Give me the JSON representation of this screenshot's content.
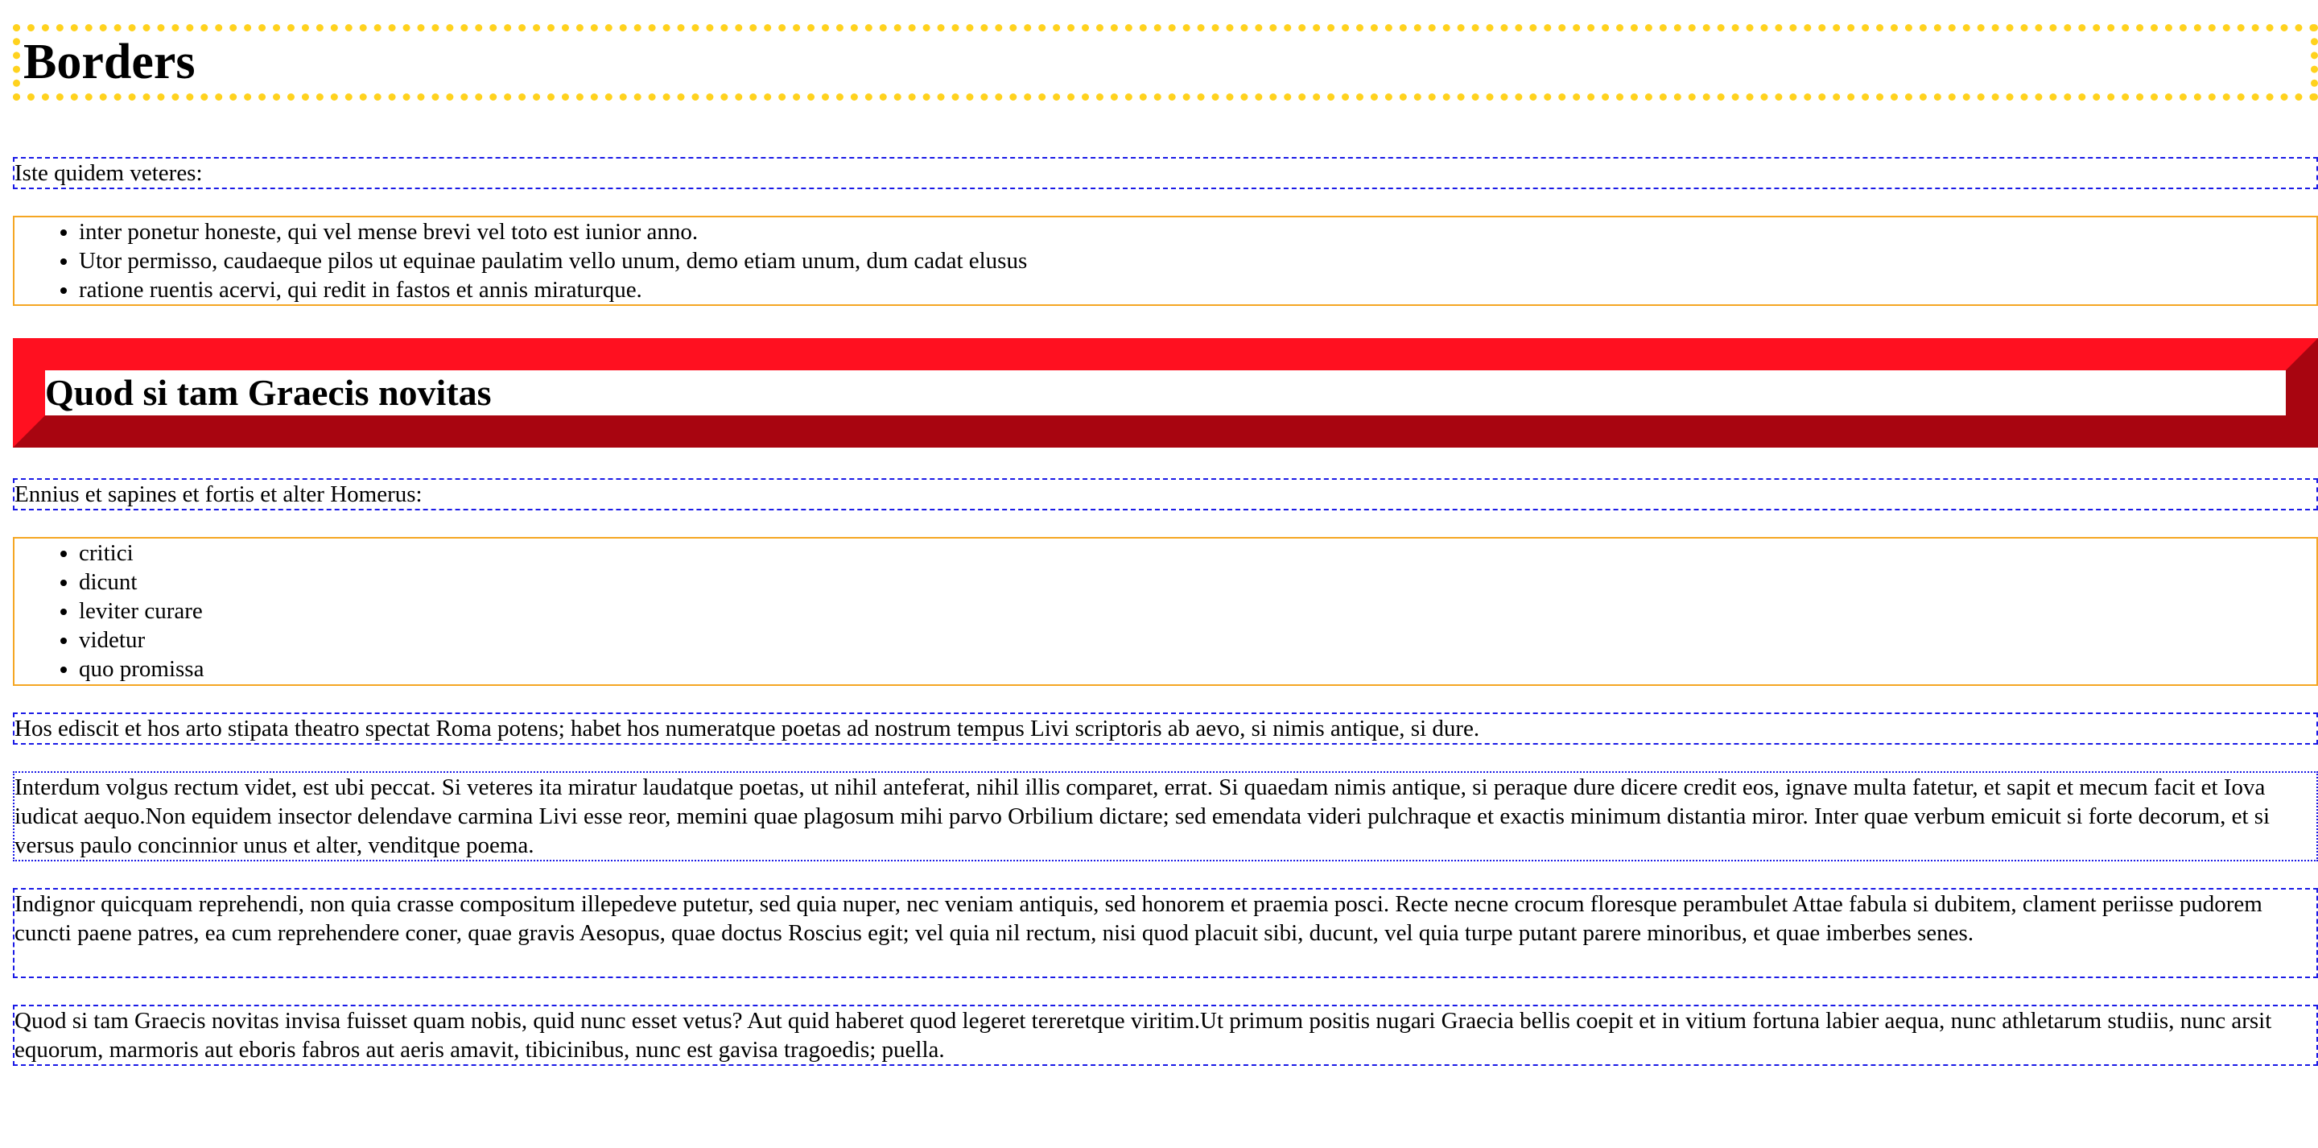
{
  "title": "Borders",
  "intro": "Iste quidem veteres:",
  "list1": [
    "inter ponetur honeste, qui vel mense brevi vel toto est iunior anno.",
    "Utor permisso, caudaeque pilos ut equinae paulatim vello unum, demo etiam unum, dum cadat elusus",
    "ratione ruentis acervi, qui redit in fastos et annis miraturque."
  ],
  "subheading": "Quod si tam Graecis novitas",
  "intro2": "Ennius et sapines et fortis et alter Homerus:",
  "list2": [
    "critici",
    "dicunt",
    "leviter curare",
    "videtur",
    "quo promissa"
  ],
  "paragraphs": [
    "Hos ediscit et hos arto stipata theatro spectat Roma potens; habet hos numeratque poetas ad nostrum tempus Livi scriptoris ab aevo, si nimis antique, si dure.",
    "Interdum volgus rectum videt, est ubi peccat. Si veteres ita miratur laudatque poetas, ut nihil anteferat, nihil illis comparet, errat. Si quaedam nimis antique, si peraque dure dicere credit eos, ignave multa fatetur, et sapit et mecum facit et Iova iudicat aequo.Non equidem insector delendave carmina Livi esse reor, memini quae plagosum mihi parvo Orbilium dictare; sed emendata videri pulchraque et exactis minimum distantia miror. Inter quae verbum emicuit si forte decorum, et si versus paulo concinnior unus et alter, venditque poema.",
    "Indignor quicquam reprehendi, non quia crasse compositum illepedeve putetur, sed quia nuper, nec veniam antiquis, sed honorem et praemia posci. Recte necne crocum floresque perambulet Attae fabula si dubitem, clament periisse pudorem cuncti paene patres, ea cum reprehendere coner, quae gravis Aesopus, quae doctus Roscius egit; vel quia nil rectum, nisi quod placuit sibi, ducunt, vel quia turpe putant parere minoribus, et quae imberbes senes.",
    "Quod si tam Graecis novitas invisa fuisset quam nobis, quid nunc esset vetus? Aut quid haberet quod legeret tereretque viritim.Ut primum positis nugari Graecia bellis coepit et in vitium fortuna labier aequa, nunc athletarum studiis, nunc arsit equorum, marmoris aut eboris fabros aut aeris amavit, tibicinibus, nunc est gavisa tragoedis; puella."
  ],
  "colors": {
    "title_border": "#ffd21e",
    "paragraph_border": "#1a1ae6",
    "list_border": "#f5a623",
    "ridge_light": "#ff1020",
    "ridge_dark": "#a80510"
  }
}
